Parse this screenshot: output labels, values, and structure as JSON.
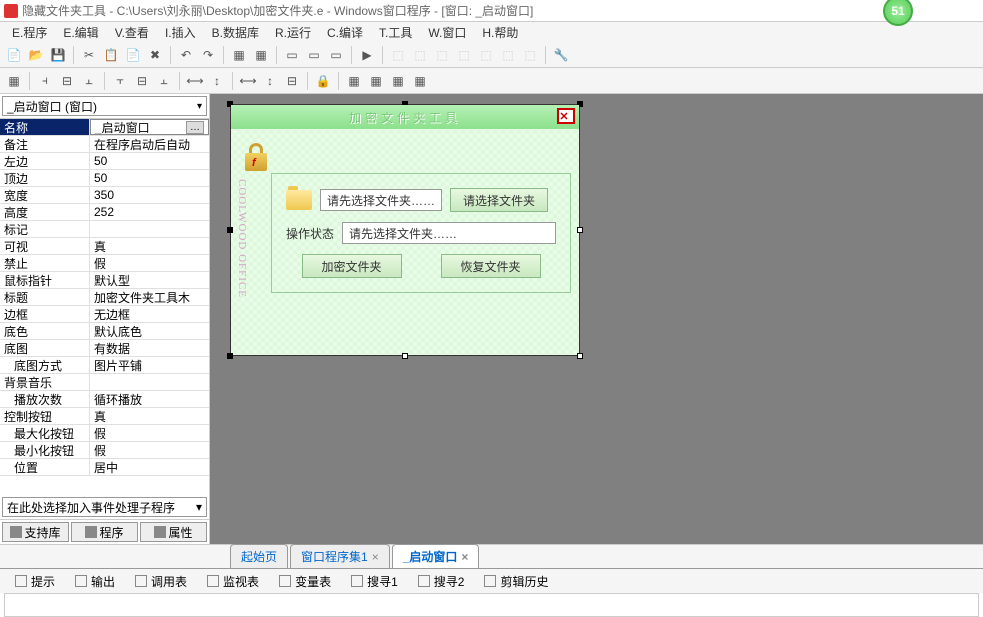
{
  "titlebar": {
    "text": "隐藏文件夹工具 - C:\\Users\\刘永丽\\Desktop\\加密文件夹.e - Windows窗口程序 - [窗口: _启动窗口]"
  },
  "badge": "51",
  "menu": {
    "items": [
      "E.程序",
      "E.编辑",
      "V.查看",
      "I.插入",
      "B.数据库",
      "R.运行",
      "C.编译",
      "T.工具",
      "W.窗口",
      "H.帮助"
    ]
  },
  "props": {
    "combo": "_启动窗口 (窗口)",
    "rows": [
      {
        "n": "名称",
        "v": "_启动窗口",
        "sel": true,
        "edit": true,
        "dots": true
      },
      {
        "n": "备注",
        "v": "在程序启动后自动"
      },
      {
        "n": "左边",
        "v": "50"
      },
      {
        "n": "顶边",
        "v": "50"
      },
      {
        "n": "宽度",
        "v": "350"
      },
      {
        "n": "高度",
        "v": "252"
      },
      {
        "n": "标记",
        "v": ""
      },
      {
        "n": "可视",
        "v": "真"
      },
      {
        "n": "禁止",
        "v": "假"
      },
      {
        "n": "鼠标指针",
        "v": "默认型"
      },
      {
        "n": "标题",
        "v": "加密文件夹工具木"
      },
      {
        "n": "边框",
        "v": "无边框"
      },
      {
        "n": "底色",
        "v": "默认底色"
      },
      {
        "n": "底图",
        "v": "有数据"
      },
      {
        "n": "底图方式",
        "v": "图片平铺",
        "indent": true
      },
      {
        "n": "背景音乐",
        "v": ""
      },
      {
        "n": "播放次数",
        "v": "循环播放",
        "indent": true
      },
      {
        "n": "控制按钮",
        "v": "真"
      },
      {
        "n": "最大化按钮",
        "v": "假",
        "indent": true
      },
      {
        "n": "最小化按钮",
        "v": "假",
        "indent": true
      },
      {
        "n": "位置",
        "v": "居中",
        "indent": true
      }
    ],
    "event": "在此处选择加入事件处理子程序",
    "btns": [
      "支持库",
      "程序",
      "属性"
    ]
  },
  "form": {
    "title": "加密文件夹工具",
    "side": "COOLWOOD OFFICE",
    "path_placeholder": "请先选择文件夹……",
    "browse": "请选择文件夹",
    "status_label": "操作状态",
    "status_value": "请先选择文件夹……",
    "encrypt": "加密文件夹",
    "restore": "恢复文件夹"
  },
  "tabs": {
    "items": [
      "起始页",
      "窗口程序集1",
      "_启动窗口"
    ],
    "activeIndex": 2
  },
  "bottom": {
    "items": [
      "提示",
      "输出",
      "调用表",
      "监视表",
      "变量表",
      "搜寻1",
      "搜寻2",
      "剪辑历史"
    ]
  }
}
